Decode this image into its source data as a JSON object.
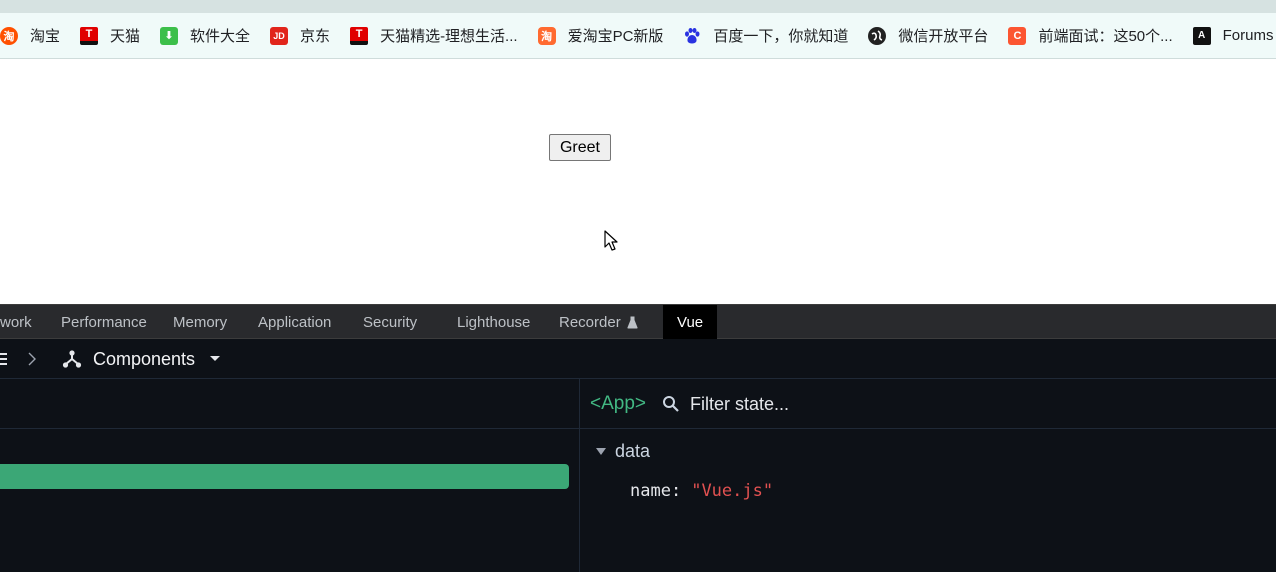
{
  "bookmarks": [
    {
      "label": "淘宝",
      "icon": "taobao-icon",
      "glyph": "淘"
    },
    {
      "label": "天猫",
      "icon": "tmall-icon",
      "glyph": "T"
    },
    {
      "label": "软件大全",
      "icon": "download-icon",
      "glyph": "⬇"
    },
    {
      "label": "京东",
      "icon": "jd-icon",
      "glyph": "JD"
    },
    {
      "label": "天猫精选-理想生活...",
      "icon": "tmall-icon",
      "glyph": "T"
    },
    {
      "label": "爱淘宝PC新版",
      "icon": "aitaobao-icon",
      "glyph": "淘"
    },
    {
      "label": "百度一下，你就知道",
      "icon": "baidu-paw-icon",
      "glyph": "🐾"
    },
    {
      "label": "微信开放平台",
      "icon": "wechat-globe-icon",
      "glyph": "◉"
    },
    {
      "label": "前端面试：这50个...",
      "icon": "csdn-icon",
      "glyph": "C"
    },
    {
      "label": "Forums -",
      "icon": "forums-icon",
      "glyph": "A"
    }
  ],
  "page": {
    "greet_button": "Greet"
  },
  "devtools": {
    "tabs": [
      "work",
      "Performance",
      "Memory",
      "Application",
      "Security",
      "Lighthouse",
      "Recorder",
      "Vue"
    ],
    "active_tab": "Vue",
    "toolbar": {
      "components_label": "Components"
    },
    "inspector": {
      "component_tag": "<App>",
      "filter_placeholder": "Filter state...",
      "section_label": "data",
      "prop_key": "name",
      "prop_value": "\"Vue.js\""
    },
    "colors": {
      "vue_green": "#42b883",
      "selected_row": "#3ba776",
      "string_value": "#e15151"
    }
  }
}
